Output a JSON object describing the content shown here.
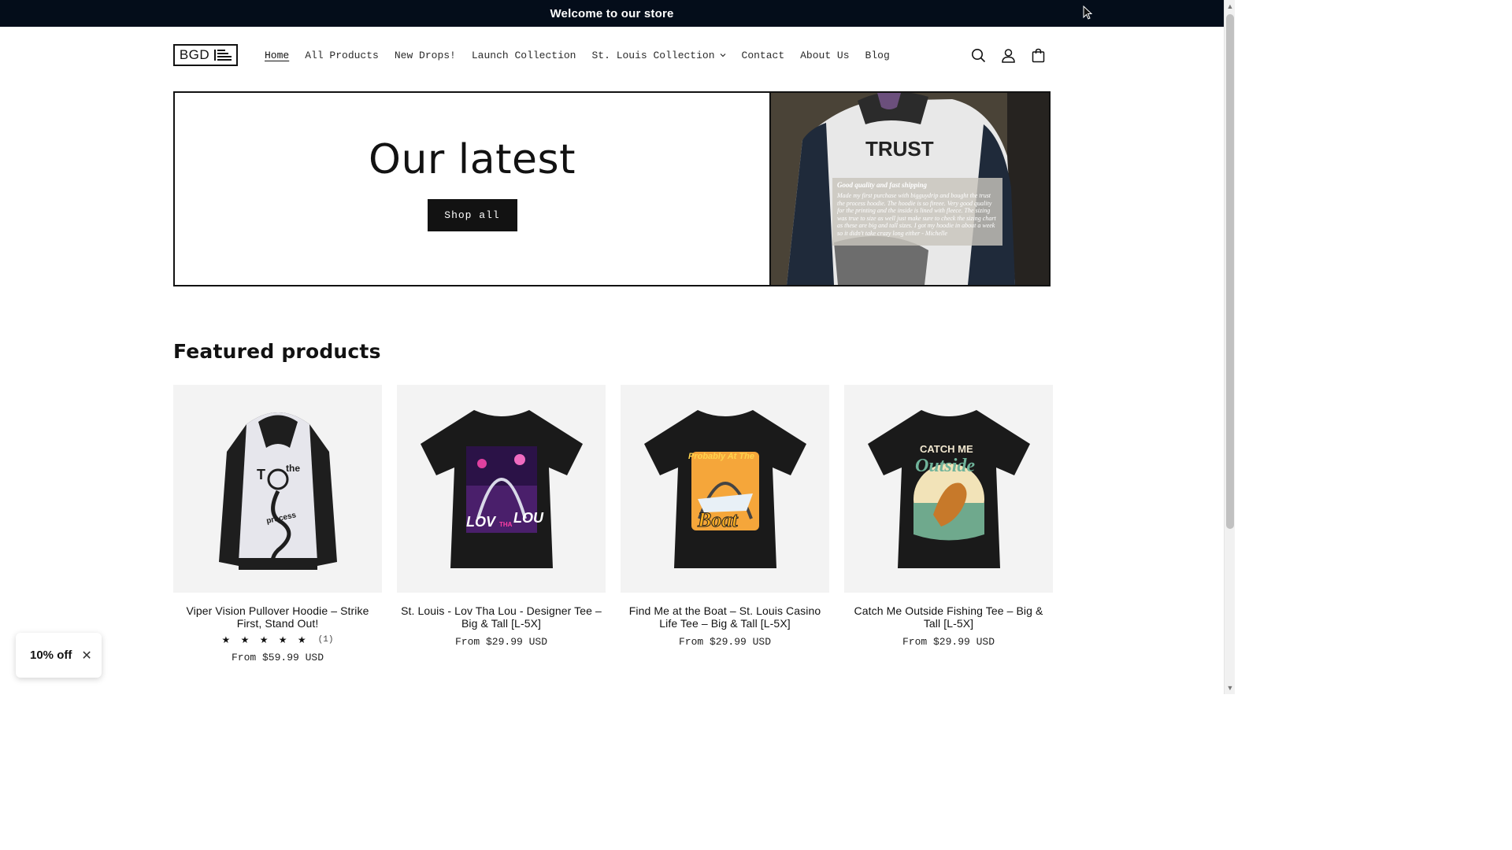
{
  "announcement": {
    "text": "Welcome to our store"
  },
  "header": {
    "logo_text": "BGD",
    "nav": [
      {
        "label": "Home",
        "active": true
      },
      {
        "label": "All Products"
      },
      {
        "label": "New Drops!"
      },
      {
        "label": "Launch Collection"
      },
      {
        "label": "St. Louis Collection",
        "has_dropdown": true
      },
      {
        "label": "Contact"
      },
      {
        "label": "About Us"
      },
      {
        "label": "Blog"
      }
    ],
    "icons": [
      "search-icon",
      "account-icon",
      "cart-icon"
    ]
  },
  "hero": {
    "title": "Our latest",
    "button_label": "Shop all",
    "review": {
      "title": "Good quality and fast shipping",
      "body": "Made my first purchase with bigguydrip and bought the trust the process hoodie. The hoodie is so fireee. Very good quality for the printing and the inside is lined with fleece. The sizing was true to size as well just make sure to check the sizing chart as these are big and tall sizes. I got my hoodie in about a week so it didn't take crazy long either - Michelle"
    }
  },
  "featured": {
    "title": "Featured products",
    "products": [
      {
        "title": "Viper Vision Pullover Hoodie – Strike First, Stand Out!",
        "stars": "★ ★ ★ ★ ★",
        "rating_count": "(1)",
        "price": "From $59.99 USD",
        "image": "hoodie"
      },
      {
        "title": "St. Louis - Lov Tha Lou - Designer Tee – Big & Tall [L-5X]",
        "price": "From $29.99 USD",
        "image": "tee-lou"
      },
      {
        "title": "Find Me at the Boat – St. Louis Casino Life Tee – Big & Tall [L-5X]",
        "price": "From $29.99 USD",
        "image": "tee-boat"
      },
      {
        "title": "Catch Me Outside Fishing Tee – Big & Tall [L-5X]",
        "price": "From $29.99 USD",
        "image": "tee-fish"
      }
    ]
  },
  "popup": {
    "label": "10% off"
  },
  "colors": {
    "announcement_bg": "#040d1a",
    "button_bg": "#121212",
    "text": "#121212"
  }
}
